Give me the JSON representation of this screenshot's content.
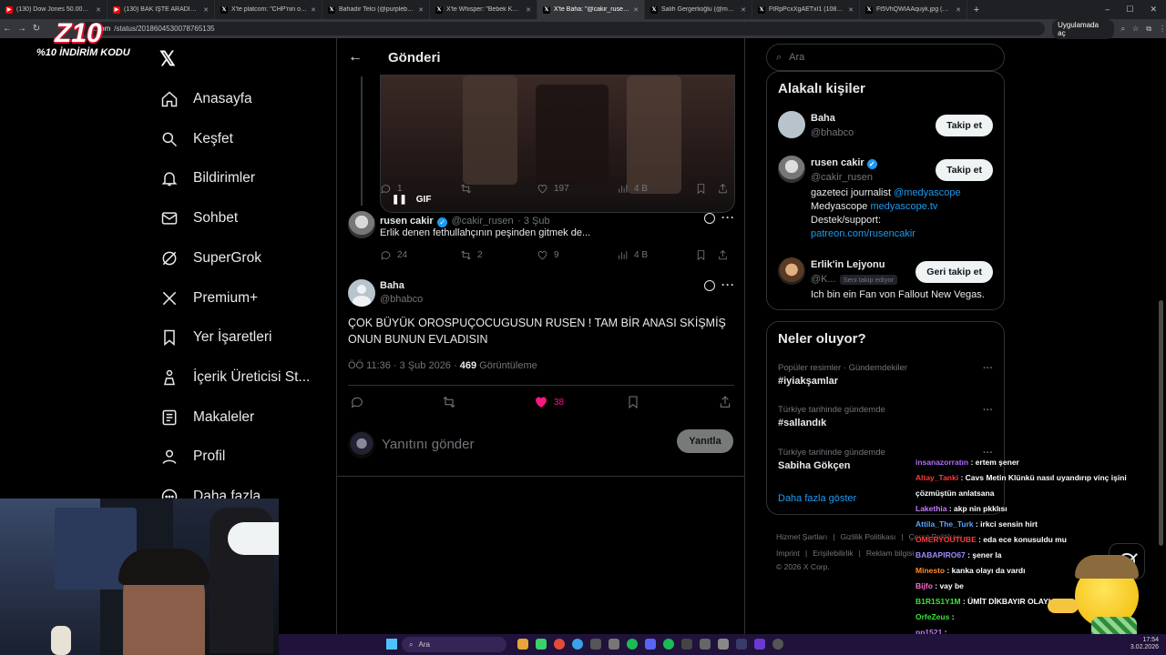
{
  "browser": {
    "tabs": [
      {
        "title": "(130) Dow Jones 50.000 Oldu !",
        "fav": "yt"
      },
      {
        "title": "(130) BAK İŞTE ARADIĞIM OYU",
        "fav": "yt"
      },
      {
        "title": "X'te platcom: \"CHP'nin oyunla",
        "fav": "x"
      },
      {
        "title": "Bahadır Telci (@purplebisi) / X",
        "fav": "x"
      },
      {
        "title": "X'te Whisper: \"Bebek Katili Abo",
        "fav": "x"
      },
      {
        "title": "X'te Baha: \"@cakir_rusen @Ka",
        "fav": "x",
        "active": true
      },
      {
        "title": "Salih Gergerlioğlu (@msalihgr",
        "fav": "x"
      },
      {
        "title": "FtRpPcxXgAETxI1 (1080×807)",
        "fav": "x"
      },
      {
        "title": "Ft5VhQWIAAquyk.jpg (864×1",
        "fav": "x"
      }
    ],
    "url_host": "x.com",
    "url_path": "/status/2018604530078765135",
    "open_in_app": "Uygulamada aç"
  },
  "promo": {
    "logo": "Z10",
    "text": "%10 İNDİRİM KODU"
  },
  "sidebar": {
    "items": [
      {
        "label": "Anasayfa",
        "icon": "home-icon"
      },
      {
        "label": "Keşfet",
        "icon": "search-icon"
      },
      {
        "label": "Bildirimler",
        "icon": "bell-icon"
      },
      {
        "label": "Sohbet",
        "icon": "mail-icon"
      },
      {
        "label": "SuperGrok",
        "icon": "grok-icon"
      },
      {
        "label": "Premium+",
        "icon": "x-premium-icon"
      },
      {
        "label": "Yer İşaretleri",
        "icon": "bookmark-icon"
      },
      {
        "label": "İçerik Üreticisi St...",
        "icon": "creator-icon"
      },
      {
        "label": "Makaleler",
        "icon": "article-icon"
      },
      {
        "label": "Profil",
        "icon": "person-icon"
      },
      {
        "label": "Daha fazla",
        "icon": "more-icon"
      }
    ]
  },
  "main": {
    "header_title": "Gönderi",
    "gif_badge": "GIF",
    "prev_actions": {
      "replies": "1",
      "retweets": "",
      "likes": "197",
      "views": "4 B"
    },
    "reply": {
      "name": "rusen cakir",
      "handle": "@cakir_rusen",
      "time": "· 3 Şub",
      "text": "Erlik denen fethullahçının peşinden gitmek de...",
      "actions": {
        "replies": "24",
        "retweets": "2",
        "likes": "9",
        "views": "4 B"
      }
    },
    "tweet": {
      "name": "Baha",
      "handle": "@bhabco",
      "text": "ÇOK BÜYÜK OROSPUÇOCUGUSUN RUSEN ! TAM BİR ANASI SKİŞMİŞ ONUN BUNUN EVLADISIN",
      "timestamp": "ÖÖ 11:36 · 3 Şub 2026 ·",
      "views": "469",
      "views_label": "Görüntüleme",
      "likes": "38",
      "like_color": "#f91880"
    },
    "reply_placeholder": "Yanıtını gönder",
    "reply_button": "Yanıtla"
  },
  "right": {
    "search_placeholder": "Ara",
    "related_title": "Alakalı kişiler",
    "people": [
      {
        "name": "Baha",
        "handle": "@bhabco",
        "button": "Takip et"
      },
      {
        "name": "rusen cakir",
        "handle": "@cakir_rusen",
        "button": "Takip et",
        "bio1": "gazeteci journalist ",
        "bio1_link": "@medyascope",
        "bio2": "Medyascope ",
        "bio2_link": "medyascope.tv",
        "bio3": "Destek/support:",
        "bio4_link": "patreon.com/rusencakir"
      },
      {
        "name": "Erlik'in Lejyonu",
        "handle": "@K...",
        "follows_you": "Seni takip ediyor",
        "button": "Geri takip et",
        "bio1": "Ich bin ein Fan von Fallout New Vegas."
      }
    ],
    "trends_title": "Neler oluyor?",
    "trends": [
      {
        "context": "Popüler resimler · Gündemdekiler",
        "name": "#iyiakşamlar"
      },
      {
        "context": "Türkiye tarihinde gündemde",
        "name": "#sallandık"
      },
      {
        "context": "Türkiye tarihinde gündemde",
        "name": "Sabiha Gökçen"
      }
    ],
    "show_more": "Daha fazla göster",
    "footer1": [
      "Hizmet Şartları",
      "|",
      "Gizlilik Politikası",
      "|",
      "Çerez Politikası"
    ],
    "footer2": [
      "Imprint",
      "|",
      "Erişilebilirlik",
      "|",
      "Reklam bilgisi"
    ],
    "copyright": "© 2026 X Corp."
  },
  "chat": [
    {
      "user": "insanazorratın",
      "color": "#b36bff",
      "msg": " : ertem şener"
    },
    {
      "user": "Altay_Tanki",
      "color": "#ff3b3b",
      "msg": " : Cavs Metin Klünkü nasıl uyandırıp vinç işini"
    },
    {
      "user": "",
      "color": "#ffffff",
      "msg": "çözmüştün anlatsana"
    },
    {
      "user": "Lakethia",
      "color": "#c47bff",
      "msg": " : akp nin pkklısı"
    },
    {
      "user": "Attila_The_Turk",
      "color": "#5aa7ff",
      "msg": " : irkci sensin hirt"
    },
    {
      "user": "OMERYOUTUBE",
      "color": "#ff3b3b",
      "msg": " : eda ece konusuldu mu"
    },
    {
      "user": "BABAPIRO67",
      "color": "#9b8cff",
      "msg": " : şener la"
    },
    {
      "user": "Minesto",
      "color": "#ff8c2a",
      "msg": " : kanka olayı da vardı"
    },
    {
      "user": "Bijfo",
      "color": "#ff6bd0",
      "msg": " : vay be"
    },
    {
      "user": "B1R1S1Y1M",
      "color": "#39e639",
      "msg": " : ÜMİT DİKBAYIR OLAYI EENA"
    },
    {
      "user": "OrfeZeus",
      "color": "#39e639",
      "msg": " :"
    },
    {
      "user": "pp1521",
      "color": "#c47bff",
      "msg": " :"
    }
  ],
  "taskbar": {
    "search": "Ara",
    "time": "17:54",
    "date": "3.02.2026"
  }
}
